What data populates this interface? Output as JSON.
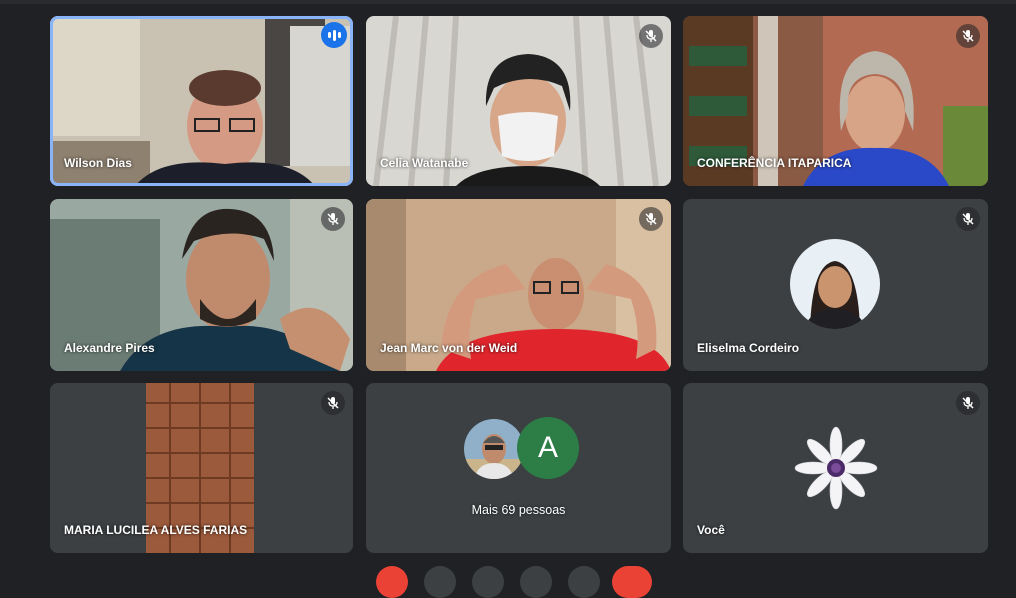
{
  "tiles": [
    {
      "name": "Wilson Dias",
      "state": "speaking"
    },
    {
      "name": "Celia Watanabe",
      "state": "muted"
    },
    {
      "name": "CONFERÊNCIA ITAPARICA",
      "state": "muted"
    },
    {
      "name": "Alexandre Pires",
      "state": "muted"
    },
    {
      "name": "Jean Marc von der Weid",
      "state": "muted"
    },
    {
      "name": "Eliselma Cordeiro",
      "state": "muted"
    },
    {
      "name": "MARIA LUCILEA ALVES FARIAS",
      "state": "muted"
    },
    {
      "name": "Mais 69 pessoas",
      "avatar_letter": "A",
      "avatar_color": "#2d7d46"
    },
    {
      "name": "Você",
      "state": "muted"
    }
  ],
  "colors": {
    "background": "#202124",
    "tile": "#3c4043",
    "speaking": "#1a73e8",
    "active_outline": "#8ab4f8"
  }
}
